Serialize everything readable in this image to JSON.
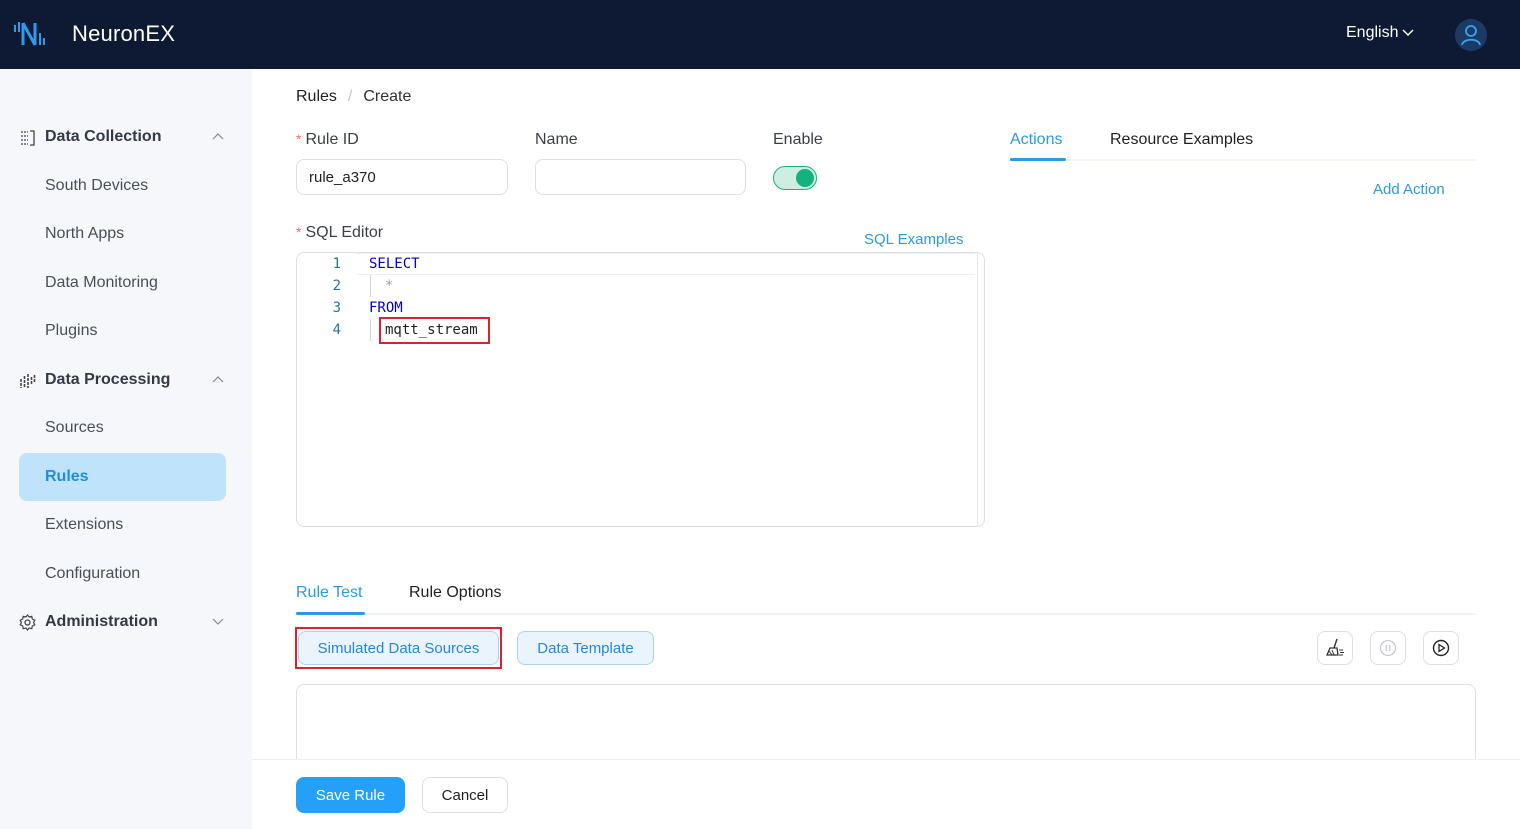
{
  "header": {
    "app_name": "NeuronEX",
    "language": "English"
  },
  "sidebar": {
    "groups": [
      {
        "label": "Data Collection",
        "icon": "list-icon",
        "expanded": true,
        "items": [
          {
            "label": "South Devices"
          },
          {
            "label": "North Apps"
          },
          {
            "label": "Data Monitoring"
          },
          {
            "label": "Plugins"
          }
        ]
      },
      {
        "label": "Data Processing",
        "icon": "bars-icon",
        "expanded": true,
        "items": [
          {
            "label": "Sources"
          },
          {
            "label": "Rules",
            "active": true
          },
          {
            "label": "Extensions"
          },
          {
            "label": "Configuration"
          }
        ]
      },
      {
        "label": "Administration",
        "icon": "gear-icon",
        "expanded": false,
        "items": []
      }
    ]
  },
  "breadcrumb": [
    "Rules",
    "Create"
  ],
  "form": {
    "rule_id_label": "Rule ID",
    "rule_id_value": "rule_a370",
    "name_label": "Name",
    "name_value": "",
    "enable_label": "Enable",
    "enabled": true,
    "sql_editor_label": "SQL Editor",
    "sql_examples_link": "SQL Examples",
    "sql_lines": [
      {
        "num": "1",
        "text": "SELECT"
      },
      {
        "num": "2",
        "text": "*"
      },
      {
        "num": "3",
        "text": "FROM"
      },
      {
        "num": "4",
        "text": "mqtt_stream"
      }
    ]
  },
  "right_panel": {
    "tabs": [
      {
        "label": "Actions",
        "active": true
      },
      {
        "label": "Resource Examples",
        "active": false
      }
    ],
    "add_action_link": "Add Action"
  },
  "bottom_panel": {
    "tabs": [
      {
        "label": "Rule Test",
        "active": true
      },
      {
        "label": "Rule Options",
        "active": false
      }
    ],
    "simulated_button": "Simulated Data Sources",
    "template_button": "Data Template"
  },
  "footer": {
    "save_label": "Save Rule",
    "cancel_label": "Cancel"
  },
  "colors": {
    "primary": "#25a0f8",
    "link": "#2a9be3",
    "topbar": "#0e1a33",
    "switch_on": "#14b37d",
    "highlight": "#d9232d"
  }
}
